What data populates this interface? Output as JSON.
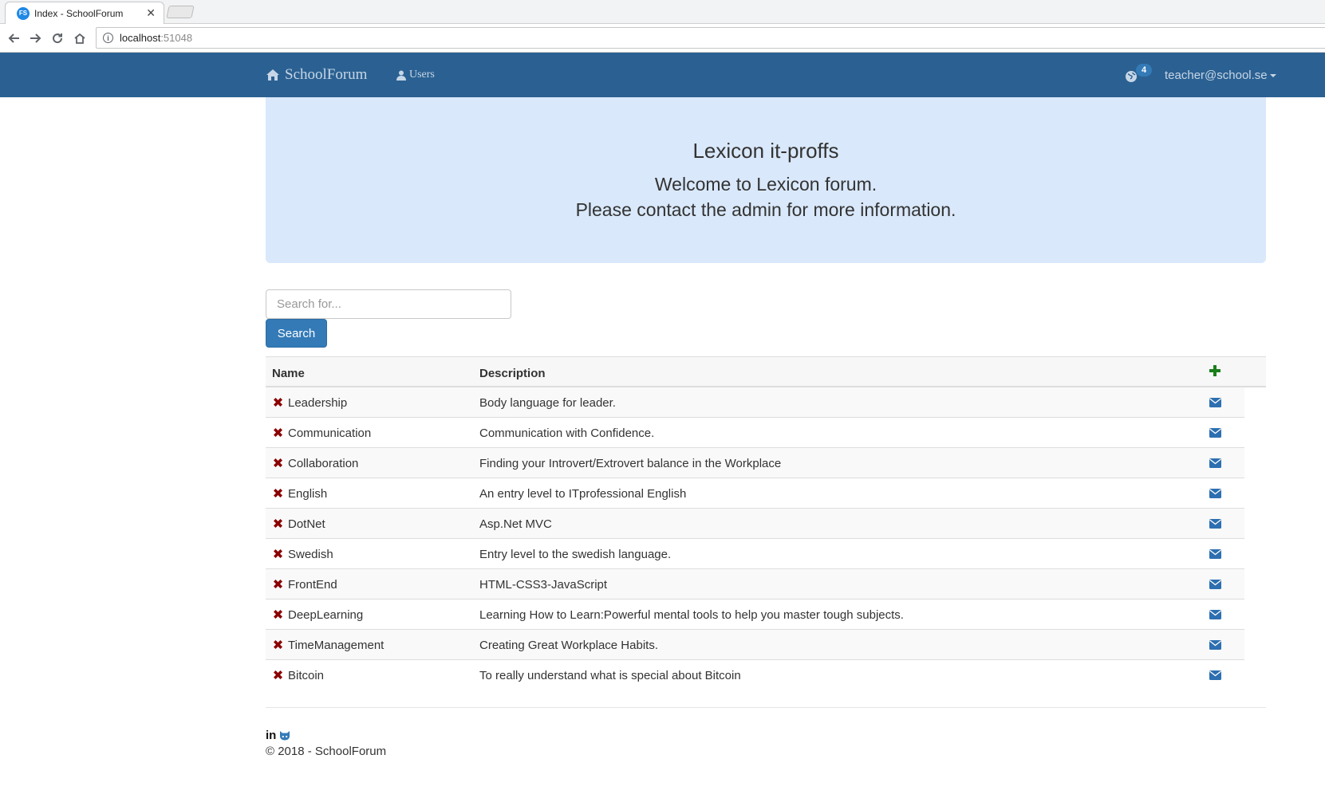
{
  "browser": {
    "tab_title": "Index - SchoolForum",
    "favicon_text": "FS",
    "url_host": "localhost",
    "url_port": ":51048"
  },
  "navbar": {
    "brand": "SchoolForum",
    "users_link": "Users",
    "notification_count": "4",
    "user_email": "teacher@school.se",
    "bg_color": "#2b6192"
  },
  "jumbotron": {
    "title": "Lexicon it-proffs",
    "line1": "Welcome to Lexicon forum.",
    "line2": "Please contact the admin for more information."
  },
  "search": {
    "placeholder": "Search for...",
    "button_label": "Search"
  },
  "table": {
    "headers": {
      "name": "Name",
      "description": "Description"
    },
    "rows": [
      {
        "name": "Leadership",
        "description": "Body language for leader."
      },
      {
        "name": "Communication",
        "description": "Communication with Confidence."
      },
      {
        "name": "Collaboration",
        "description": "Finding your Introvert/Extrovert balance in the Workplace"
      },
      {
        "name": "English",
        "description": "An entry level to ITprofessional English"
      },
      {
        "name": "DotNet",
        "description": "Asp.Net MVC"
      },
      {
        "name": "Swedish",
        "description": "Entry level to the swedish language."
      },
      {
        "name": "FrontEnd",
        "description": "HTML-CSS3-JavaScript"
      },
      {
        "name": "DeepLearning",
        "description": "Learning How to Learn:Powerful mental tools to help you master tough subjects."
      },
      {
        "name": "TimeManagement",
        "description": "Creating Great Workplace Habits."
      },
      {
        "name": "Bitcoin",
        "description": "To really understand what is special about Bitcoin"
      }
    ]
  },
  "footer": {
    "linkedin_label": "in",
    "copyright": "© 2018 - SchoolForum"
  },
  "icons": {
    "delete": "remove-x-icon",
    "mail": "envelope-icon",
    "add": "plus-icon",
    "home": "home-icon",
    "users": "user-icon",
    "notifications": "globe-icon",
    "github": "github-icon"
  },
  "colors": {
    "primary": "#337ab7",
    "danger": "#8b0000",
    "success": "#1a7f1a",
    "jumbotron_bg": "#d9e8fa"
  }
}
